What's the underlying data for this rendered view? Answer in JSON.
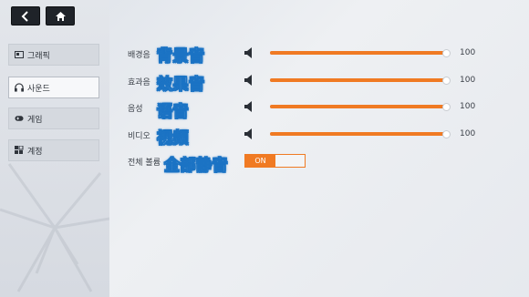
{
  "nav": {
    "back_icon": "back-arrow-icon",
    "home_icon": "home-icon",
    "items": [
      {
        "label": "그래픽",
        "icon": "graphics-icon",
        "active": false
      },
      {
        "label": "사운드",
        "icon": "headphones-icon",
        "active": true
      },
      {
        "label": "게임",
        "icon": "gamepad-icon",
        "active": false
      },
      {
        "label": "계정",
        "icon": "account-icon",
        "active": false
      }
    ]
  },
  "sound": {
    "rows": [
      {
        "label": "배경음",
        "cn": "背景音",
        "value": "100",
        "level": 1.0
      },
      {
        "label": "효과음",
        "cn": "效果音",
        "value": "100",
        "level": 1.0
      },
      {
        "label": "음성",
        "cn": "语音",
        "value": "100",
        "level": 1.0
      },
      {
        "label": "비디오",
        "cn": "视频",
        "value": "100",
        "level": 1.0
      }
    ],
    "mute": {
      "label": "전체 볼륨",
      "cn": "全部静音",
      "toggle_label": "ON",
      "state": "on"
    }
  },
  "colors": {
    "accent": "#f07a23",
    "annotation": "#1b73c4"
  }
}
